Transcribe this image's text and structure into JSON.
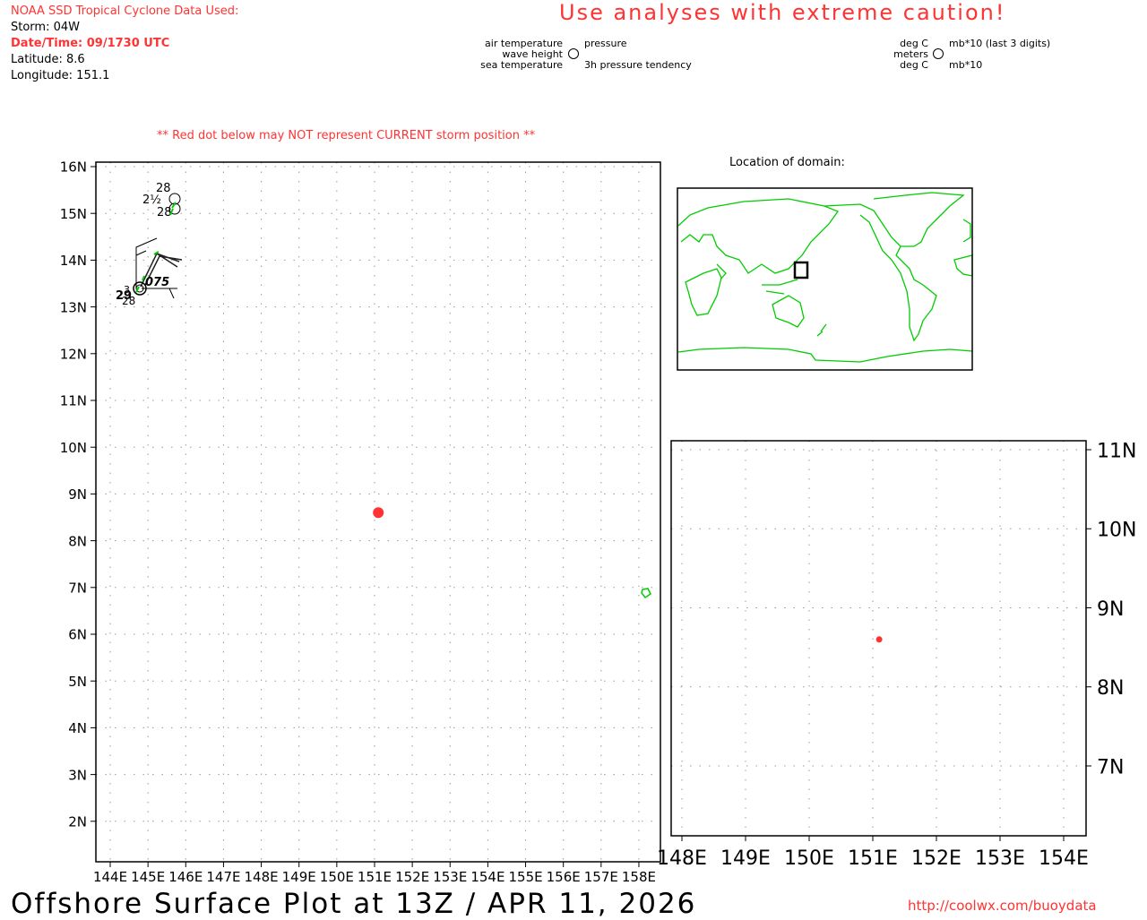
{
  "header": {
    "source_title": "NOAA SSD Tropical Cyclone Data Used:",
    "storm": "Storm: 04W",
    "datetime": "Date/Time: 09/1730 UTC",
    "latitude": "Latitude: 8.6",
    "longitude": "Longitude: 151.1",
    "caution": "Use analyses with extreme caution!",
    "red_dot_warning": "** Red dot below may NOT represent CURRENT storm position **"
  },
  "legend": {
    "air_temperature": "air temperature",
    "wave_height": "wave height",
    "sea_temperature": "sea temperature",
    "pressure": "pressure",
    "pressure_tendency": "3h pressure tendency",
    "unit_air": "deg C",
    "unit_wave": "meters",
    "unit_sea": "deg C",
    "unit_pressure": "mb*10 (last 3 digits)",
    "unit_tendency": "mb*10"
  },
  "locator": {
    "title": "Location of domain:"
  },
  "footer": {
    "title": "Offshore Surface Plot at 13Z / APR 11, 2026",
    "url": "http://coolwx.com/buoydata"
  },
  "colors": {
    "storm_dot": "#ff3333",
    "coastline": "#00cc00",
    "warning_text": "#ff3333"
  },
  "main_map": {
    "lon_ticks": [
      "144E",
      "145E",
      "146E",
      "147E",
      "148E",
      "149E",
      "150E",
      "151E",
      "152E",
      "153E",
      "154E",
      "155E",
      "156E",
      "157E",
      "158E"
    ],
    "lat_ticks": [
      "16N",
      "15N",
      "14N",
      "13N",
      "12N",
      "11N",
      "10N",
      "9N",
      "8N",
      "7N",
      "6N",
      "5N",
      "4N",
      "3N",
      "2N"
    ],
    "storm_position": {
      "lat": 8.6,
      "lon": 151.1
    },
    "observations": [
      {
        "air_temp": "28",
        "wave_height": "2½",
        "sea_temp": "28"
      },
      {
        "air_temp": "3",
        "sea_temp": "28",
        "pressure_label": "29",
        "pressure": "075"
      }
    ]
  },
  "inset_map": {
    "lon_ticks": [
      "148E",
      "149E",
      "150E",
      "151E",
      "152E",
      "153E",
      "154E"
    ],
    "lat_ticks": [
      "11N",
      "10N",
      "9N",
      "8N",
      "7N"
    ],
    "storm_position": {
      "lat": 8.6,
      "lon": 151.1
    }
  }
}
